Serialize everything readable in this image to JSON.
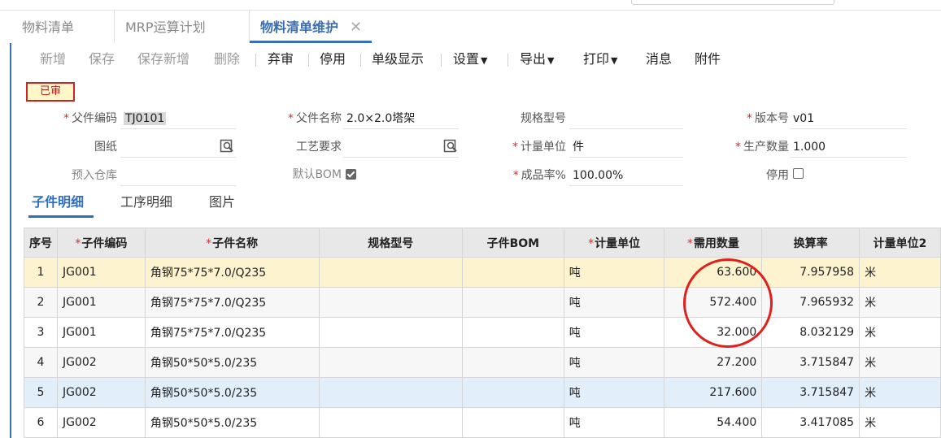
{
  "tabs": [
    {
      "label": "物料清单",
      "active": false
    },
    {
      "label": "MRP运算计划",
      "active": false
    },
    {
      "label": "物料清单维护",
      "active": true,
      "closable": true
    }
  ],
  "toolbar": {
    "new": "新增",
    "save": "保存",
    "save_new": "保存新增",
    "delete": "删除",
    "unapprove": "弃审",
    "disable": "停用",
    "single_level": "单级显示",
    "settings": "设置",
    "export": "导出",
    "print": "打印",
    "message": "消息",
    "attachment": "附件"
  },
  "status_badge": "已审",
  "form": {
    "parent_code_label": "父件编码",
    "parent_code": "TJ0101",
    "parent_name_label": "父件名称",
    "parent_name": "2.0×2.0塔架",
    "spec_label": "规格型号",
    "spec": "",
    "version_label": "版本号",
    "version": "v01",
    "drawing_label": "图纸",
    "drawing": "",
    "process_req_label": "工艺要求",
    "process_req": "",
    "unit_label": "计量单位",
    "unit": "件",
    "prod_qty_label": "生产数量",
    "prod_qty": "1.000",
    "pre_warehouse_label": "预入仓库",
    "pre_warehouse": "",
    "default_bom_label": "默认BOM",
    "default_bom_checked": true,
    "yield_label": "成品率%",
    "yield": "100.00%",
    "disabled_label": "停用",
    "disabled_checked": false
  },
  "subtabs": [
    "子件明细",
    "工序明细",
    "图片"
  ],
  "table": {
    "headers": [
      "序号",
      "子件编码",
      "子件名称",
      "规格型号",
      "子件BOM",
      "计量单位",
      "需用数量",
      "换算率",
      "计量单位2"
    ],
    "required": [
      false,
      true,
      true,
      false,
      false,
      true,
      true,
      false,
      false
    ],
    "rows": [
      [
        "1",
        "JG001",
        "角钢75*75*7.0/Q235",
        "",
        "",
        "吨",
        "63.600",
        "7.957958",
        "米"
      ],
      [
        "2",
        "JG001",
        "角钢75*75*7.0/Q235",
        "",
        "",
        "吨",
        "572.400",
        "7.965932",
        "米"
      ],
      [
        "3",
        "JG001",
        "角钢75*75*7.0/Q235",
        "",
        "",
        "吨",
        "32.000",
        "8.032129",
        "米"
      ],
      [
        "4",
        "JG002",
        "角钢50*50*5.0/235",
        "",
        "",
        "吨",
        "27.200",
        "3.715847",
        "米"
      ],
      [
        "5",
        "JG002",
        "角钢50*50*5.0/235",
        "",
        "",
        "吨",
        "217.600",
        "3.715847",
        "米"
      ],
      [
        "6",
        "JG002",
        "角钢50*50*5.0/235",
        "",
        "",
        "吨",
        "54.400",
        "3.417085",
        "米"
      ]
    ]
  },
  "colors": {
    "accent": "#3a6fb5",
    "badge_border": "#c62828",
    "badge_bg": "#fff7c9",
    "selected_row": "#fdf3cf",
    "hover_row": "#e3eefb",
    "annotation_circle": "#e0201c"
  }
}
